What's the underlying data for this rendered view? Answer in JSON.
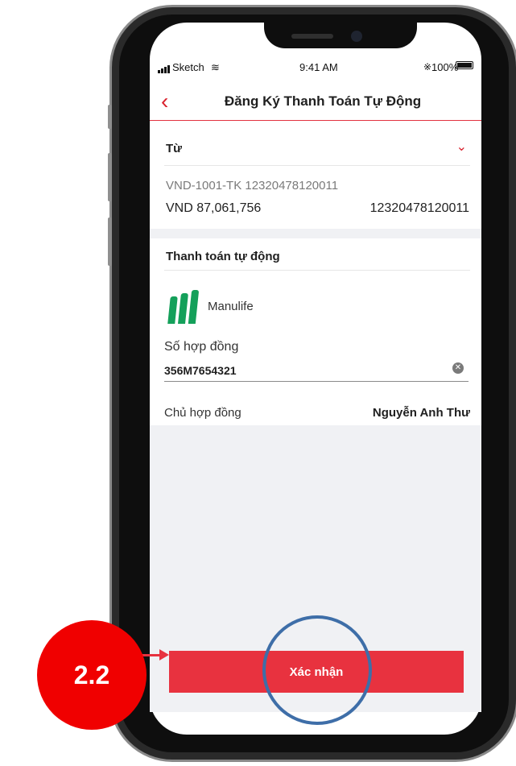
{
  "status_bar": {
    "carrier": "Sketch",
    "time": "9:41 AM",
    "battery": "100%"
  },
  "header": {
    "title": "Đăng Ký Thanh Toán Tự Động"
  },
  "from": {
    "label": "Từ",
    "account_line": "VND-1001-TK 12320478120011",
    "balance": "VND 87,061,756",
    "account_number": "12320478120011"
  },
  "auto_payment": {
    "title": "Thanh toán tự động",
    "provider": "Manulife",
    "contract_label": "Số hợp đồng",
    "contract_value": "356M7654321",
    "owner_label": "Chủ hợp đồng",
    "owner_value": "Nguyễn Anh Thư"
  },
  "confirm_label": "Xác nhận",
  "annotation": {
    "step": "2.2",
    "accent": "#f00000",
    "circle_color": "#3e6ea8"
  },
  "icons": [
    "back-icon",
    "chevron-down-icon",
    "clear-icon",
    "wifi-icon",
    "battery-icon",
    "bluetooth-icon",
    "manulife-logo"
  ]
}
